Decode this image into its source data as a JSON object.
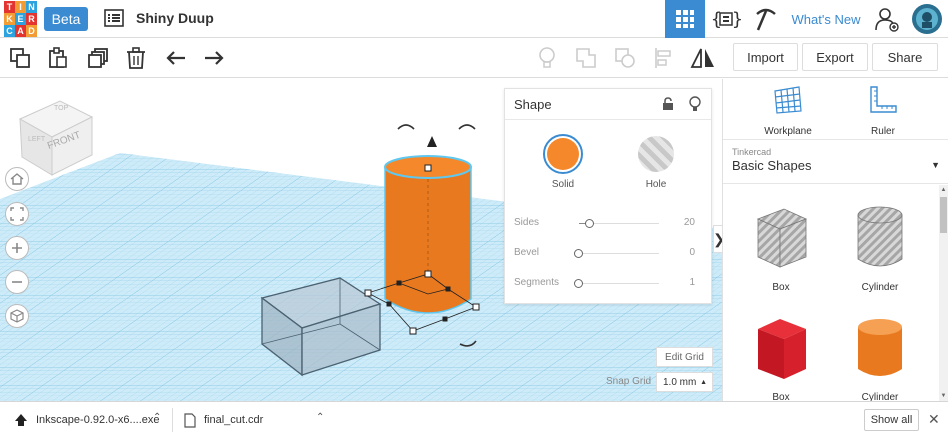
{
  "header": {
    "logo_letters": [
      "T",
      "I",
      "N",
      "K",
      "E",
      "R",
      "C",
      "A",
      "D"
    ],
    "beta": "Beta",
    "title": "Shiny Duup",
    "whats_new": "What's New"
  },
  "toolbar": {
    "import": "Import",
    "export": "Export",
    "share": "Share"
  },
  "viewcube": {
    "front": "FRONT",
    "top": "TOP",
    "left": "LEFT"
  },
  "shape_panel": {
    "title": "Shape",
    "solid": "Solid",
    "hole": "Hole",
    "sides_label": "Sides",
    "sides_value": "20",
    "bevel_label": "Bevel",
    "bevel_value": "0",
    "segments_label": "Segments",
    "segments_value": "1"
  },
  "grid": {
    "edit_grid": "Edit Grid",
    "snap_label": "Snap Grid",
    "snap_value": "1.0 mm"
  },
  "sidebar": {
    "workplane": "Workplane",
    "ruler": "Ruler",
    "library_source": "Tinkercad",
    "library_name": "Basic Shapes",
    "shapes": [
      "Box",
      "Cylinder",
      "Box",
      "Cylinder"
    ]
  },
  "downloads": {
    "file1": "Inkscape-0.92.0-x6....exe",
    "file2": "final_cut.cdr",
    "show_all": "Show all"
  },
  "colors": {
    "accent": "#3a8bd1",
    "orange": "#f5882a",
    "grid_blue": "#bfe6f7",
    "box_red": "#d6202c"
  }
}
